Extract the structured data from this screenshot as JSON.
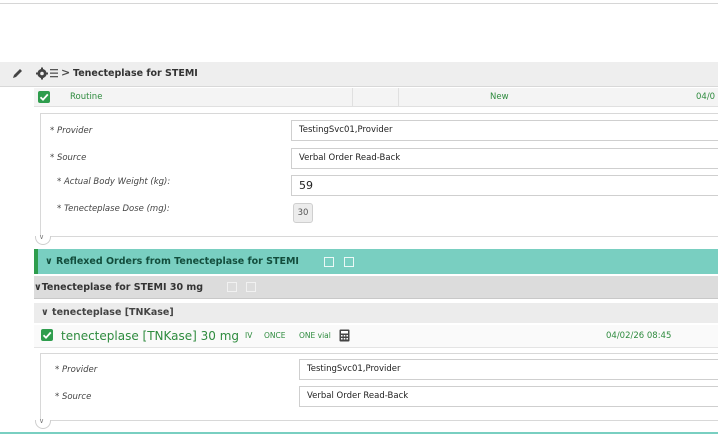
{
  "header": {
    "title": "Tenecteplase for STEMI"
  },
  "order_row": {
    "priority": "Routine",
    "status": "New",
    "date": "04/0"
  },
  "details": {
    "provider_label": "* Provider",
    "provider_value": "TestingSvc01,Provider",
    "source_label": "* Source",
    "source_value": "Verbal Order Read-Back",
    "weight_label": "* Actual Body Weight (kg):",
    "weight_value": "59",
    "dose_label": "* Tenecteplase Dose (mg):",
    "dose_value": "30"
  },
  "reflexed": {
    "title": "Reflexed Orders from Tenecteplase for STEMI"
  },
  "group": {
    "title": "Tenecteplase for STEMI 30 mg"
  },
  "subgroup": {
    "title": "tenecteplase [TNKase]"
  },
  "drug_row": {
    "name": "tenecteplase [TNKase] 30 mg",
    "route": "IV",
    "frequency": "ONCE",
    "quantity": "ONE vial",
    "date": "04/02/26 08:45"
  },
  "details2": {
    "provider_label": "* Provider",
    "provider_value": "TestingSvc01,Provider",
    "source_label": "* Source",
    "source_value": "Verbal Order Read-Back"
  },
  "colors": {
    "accent_green": "#2e9d4d",
    "teal_bar": "#79cfc1"
  }
}
